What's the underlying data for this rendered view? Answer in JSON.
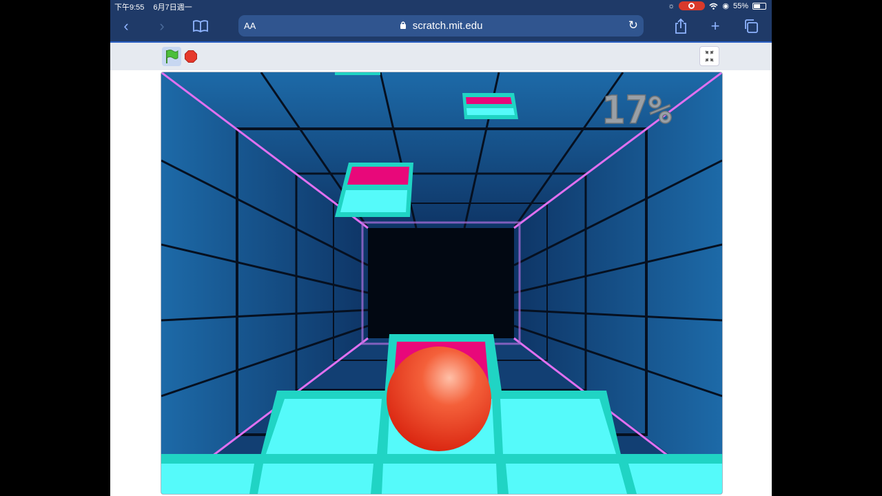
{
  "status_bar": {
    "time": "下午9:55",
    "date": "6月7日週一",
    "battery": "55%",
    "battery_level": 0.55
  },
  "browser": {
    "text_size": "AA",
    "url": "scratch.mit.edu"
  },
  "game": {
    "progress_text": "17%"
  },
  "colors": {
    "toolbar": "#1f3a68",
    "tile_cyan": "#55fafa",
    "tile_edge": "#20d4c4",
    "tile_pink": "#e8087a",
    "ball": "#e8301a",
    "rail_pink": "#e070f0"
  },
  "icons": [
    "back-chevron-icon",
    "forward-chevron-icon",
    "bookmarks-icon",
    "lock-icon",
    "reload-icon",
    "share-icon",
    "plus-icon",
    "tabs-icon",
    "green-flag-icon",
    "stop-icon",
    "exit-fullscreen-icon",
    "wifi-icon",
    "battery-icon"
  ]
}
